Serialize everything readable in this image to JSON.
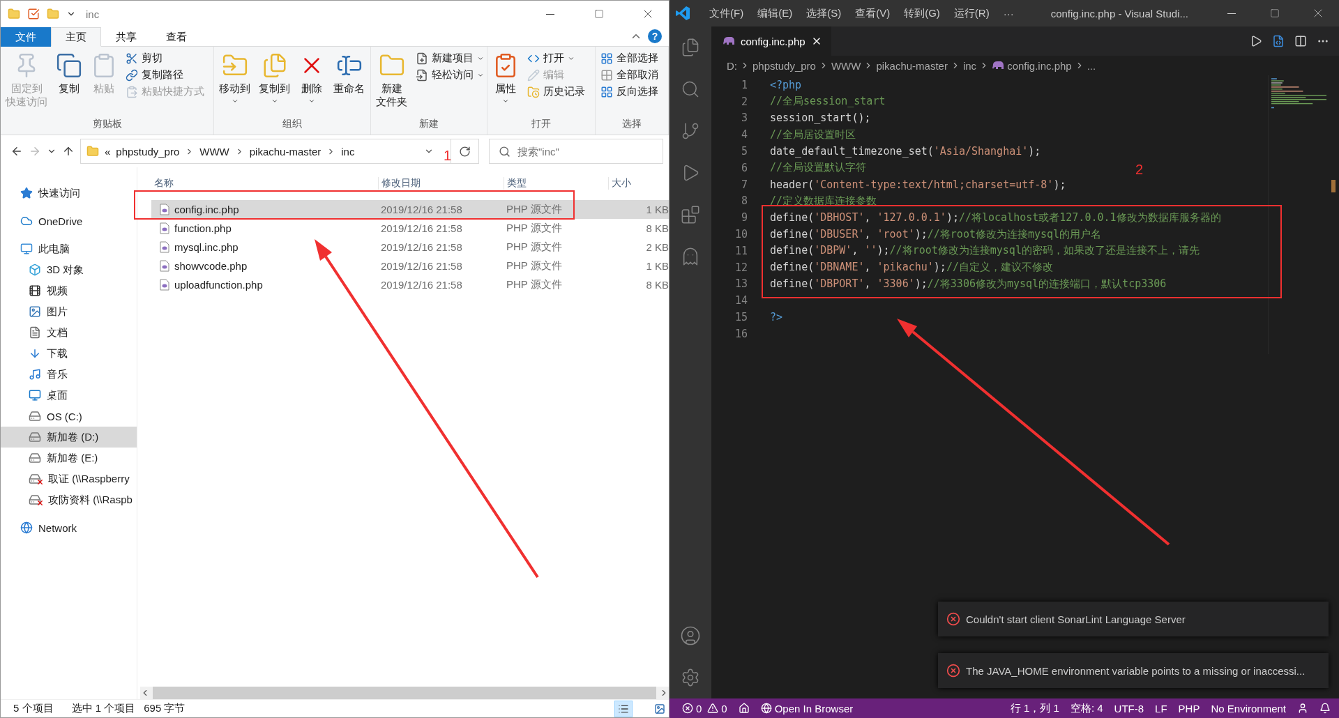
{
  "explorer": {
    "title": "inc",
    "help": "?",
    "ribbon_tabs": [
      {
        "label": "文件",
        "kind": "file",
        "selected": false
      },
      {
        "label": "主页",
        "kind": "tab",
        "selected": true
      },
      {
        "label": "共享",
        "kind": "tab",
        "selected": false
      },
      {
        "label": "查看",
        "kind": "tab",
        "selected": false
      }
    ],
    "ribbon_groups": [
      {
        "label": "剪贴板",
        "items": [
          {
            "kind": "large",
            "lines": [
              "固定到",
              "快速访问"
            ],
            "disabled": true
          },
          {
            "kind": "large",
            "label": "复制",
            "disabled": false
          },
          {
            "kind": "large",
            "label": "粘贴",
            "disabled": true
          },
          {
            "kind": "small",
            "label": "剪切",
            "disabled": false
          },
          {
            "kind": "small",
            "label": "复制路径",
            "disabled": false
          },
          {
            "kind": "small",
            "label": "粘贴快捷方式",
            "disabled": true
          }
        ]
      },
      {
        "label": "组织",
        "items": [
          {
            "kind": "large",
            "label": "移动到",
            "disabled": false,
            "dropdown": true
          },
          {
            "kind": "large",
            "label": "复制到",
            "disabled": false,
            "dropdown": true
          },
          {
            "kind": "large",
            "label": "删除",
            "disabled": false,
            "dropdown": true
          },
          {
            "kind": "large",
            "label": "重命名",
            "disabled": false
          }
        ]
      },
      {
        "label": "新建",
        "items": [
          {
            "kind": "large",
            "lines": [
              "新建",
              "文件夹"
            ],
            "disabled": false
          },
          {
            "kind": "small",
            "label": "新建项目",
            "disabled": false,
            "dropdown": true
          },
          {
            "kind": "small",
            "label": "轻松访问",
            "disabled": false,
            "dropdown": true
          }
        ]
      },
      {
        "label": "打开",
        "items": [
          {
            "kind": "large",
            "label": "属性",
            "disabled": false,
            "dropdown": true
          },
          {
            "kind": "small",
            "label": "打开",
            "disabled": false,
            "dropdown": true
          },
          {
            "kind": "small",
            "label": "编辑",
            "disabled": true
          },
          {
            "kind": "small",
            "label": "历史记录",
            "disabled": false
          }
        ]
      },
      {
        "label": "选择",
        "items": [
          {
            "kind": "small",
            "label": "全部选择",
            "disabled": false
          },
          {
            "kind": "small",
            "label": "全部取消",
            "disabled": false
          },
          {
            "kind": "small",
            "label": "反向选择",
            "disabled": false
          }
        ]
      }
    ],
    "address": {
      "overflow_mark": "«",
      "crumbs": [
        "phpstudy_pro",
        "WWW",
        "pikachu-master",
        "inc"
      ]
    },
    "search": {
      "placeholder": "搜索\"inc\""
    },
    "sidebar": [
      {
        "label": "快速访问",
        "selected": false
      },
      {
        "label": "OneDrive",
        "selected": false
      },
      {
        "label": "此电脑",
        "selected": false,
        "children": [
          {
            "label": "3D 对象",
            "selected": false
          },
          {
            "label": "视频",
            "selected": false
          },
          {
            "label": "图片",
            "selected": false
          },
          {
            "label": "文档",
            "selected": false
          },
          {
            "label": "下载",
            "selected": false
          },
          {
            "label": "音乐",
            "selected": false
          },
          {
            "label": "桌面",
            "selected": false
          },
          {
            "label": "OS (C:)",
            "selected": false
          },
          {
            "label": "新加卷 (D:)",
            "selected": true
          },
          {
            "label": "新加卷 (E:)",
            "selected": false
          },
          {
            "label": "取证 (\\\\Raspberry",
            "selected": false
          },
          {
            "label": "攻防资料 (\\\\Raspb",
            "selected": false
          }
        ]
      },
      {
        "label": "Network",
        "selected": false
      }
    ],
    "columns": [
      "名称",
      "修改日期",
      "类型",
      "大小"
    ],
    "rows": [
      {
        "name": "config.inc.php",
        "date": "2019/12/16 21:58",
        "type": "PHP 源文件",
        "size": "1 KB",
        "selected": true
      },
      {
        "name": "function.php",
        "date": "2019/12/16 21:58",
        "type": "PHP 源文件",
        "size": "8 KB",
        "selected": false
      },
      {
        "name": "mysql.inc.php",
        "date": "2019/12/16 21:58",
        "type": "PHP 源文件",
        "size": "2 KB",
        "selected": false
      },
      {
        "name": "showvcode.php",
        "date": "2019/12/16 21:58",
        "type": "PHP 源文件",
        "size": "1 KB",
        "selected": false
      },
      {
        "name": "uploadfunction.php",
        "date": "2019/12/16 21:58",
        "type": "PHP 源文件",
        "size": "8 KB",
        "selected": false
      }
    ],
    "status": {
      "item_count": "5 个项目",
      "selection": "选中 1 个项目",
      "size": "695 字节"
    },
    "view_buttons": [
      {
        "selected": true
      },
      {
        "selected": false
      }
    ]
  },
  "vscode": {
    "menu": [
      "文件(F)",
      "编辑(E)",
      "选择(S)",
      "查看(V)",
      "转到(G)",
      "运行(R)"
    ],
    "more": "···",
    "title": "config.inc.php - Visual Studi...",
    "tab": {
      "label": "config.inc.php"
    },
    "breadcrumbs": [
      {
        "label": "D:",
        "kind": "folder"
      },
      {
        "label": "phpstudy_pro",
        "kind": "folder"
      },
      {
        "label": "WWW",
        "kind": "folder"
      },
      {
        "label": "pikachu-master",
        "kind": "folder"
      },
      {
        "label": "inc",
        "kind": "folder"
      },
      {
        "label": "config.inc.php",
        "kind": "file"
      },
      {
        "label": "...",
        "kind": "more"
      }
    ],
    "code_lines": [
      {
        "number": "1",
        "segments": [
          {
            "kind": "tag",
            "text": "<?php"
          }
        ]
      },
      {
        "number": "2",
        "segments": [
          {
            "kind": "comment",
            "text": "//全局session_start"
          }
        ]
      },
      {
        "number": "3",
        "segments": [
          {
            "kind": "plain",
            "text": "session_start();"
          }
        ]
      },
      {
        "number": "4",
        "segments": [
          {
            "kind": "comment",
            "text": "//全局居设置时区"
          }
        ]
      },
      {
        "number": "5",
        "segments": [
          {
            "kind": "plain",
            "text": "date_default_timezone_set("
          },
          {
            "kind": "string",
            "text": "'Asia/Shanghai'"
          },
          {
            "kind": "plain",
            "text": ");"
          }
        ]
      },
      {
        "number": "6",
        "segments": [
          {
            "kind": "comment",
            "text": "//全局设置默认字符"
          }
        ]
      },
      {
        "number": "7",
        "segments": [
          {
            "kind": "plain",
            "text": "header("
          },
          {
            "kind": "string",
            "text": "'Content-type:text/html;charset=utf-8'"
          },
          {
            "kind": "plain",
            "text": ");"
          }
        ]
      },
      {
        "number": "8",
        "segments": [
          {
            "kind": "comment",
            "text": "//定义数据库连接参数"
          }
        ]
      },
      {
        "number": "9",
        "segments": [
          {
            "kind": "plain",
            "text": "define("
          },
          {
            "kind": "string",
            "text": "'DBHOST'"
          },
          {
            "kind": "plain",
            "text": ", "
          },
          {
            "kind": "string",
            "text": "'127.0.0.1'"
          },
          {
            "kind": "plain",
            "text": ");"
          },
          {
            "kind": "comment",
            "text": "//将localhost或者127.0.0.1修改为数据库服务器的"
          }
        ]
      },
      {
        "number": "10",
        "segments": [
          {
            "kind": "plain",
            "text": "define("
          },
          {
            "kind": "string",
            "text": "'DBUSER'"
          },
          {
            "kind": "plain",
            "text": ", "
          },
          {
            "kind": "string",
            "text": "'root'"
          },
          {
            "kind": "plain",
            "text": ");"
          },
          {
            "kind": "comment",
            "text": "//将root修改为连接mysql的用户名"
          }
        ]
      },
      {
        "number": "11",
        "segments": [
          {
            "kind": "plain",
            "text": "define("
          },
          {
            "kind": "string",
            "text": "'DBPW'"
          },
          {
            "kind": "plain",
            "text": ", "
          },
          {
            "kind": "string",
            "text": "''"
          },
          {
            "kind": "plain",
            "text": ");"
          },
          {
            "kind": "comment",
            "text": "//将root修改为连接mysql的密码，如果改了还是连接不上，请先"
          }
        ]
      },
      {
        "number": "12",
        "segments": [
          {
            "kind": "plain",
            "text": "define("
          },
          {
            "kind": "string",
            "text": "'DBNAME'"
          },
          {
            "kind": "plain",
            "text": ", "
          },
          {
            "kind": "string",
            "text": "'pikachu'"
          },
          {
            "kind": "plain",
            "text": ");"
          },
          {
            "kind": "comment",
            "text": "//自定义，建议不修改"
          }
        ]
      },
      {
        "number": "13",
        "segments": [
          {
            "kind": "plain",
            "text": "define("
          },
          {
            "kind": "string",
            "text": "'DBPORT'"
          },
          {
            "kind": "plain",
            "text": ", "
          },
          {
            "kind": "string",
            "text": "'3306'"
          },
          {
            "kind": "plain",
            "text": ");"
          },
          {
            "kind": "comment",
            "text": "//将3306修改为mysql的连接端口，默认tcp3306"
          }
        ]
      },
      {
        "number": "14"
      },
      {
        "number": "15",
        "segments": [
          {
            "kind": "tag",
            "text": "?>"
          }
        ]
      },
      {
        "number": "16"
      }
    ],
    "notifications": [
      {
        "message": "Couldn't start client SonarLint Language Server"
      },
      {
        "message": "The JAVA_HOME environment variable points to a missing or inaccessi..."
      }
    ],
    "status_bar": {
      "errors": "0",
      "warnings": "0",
      "open_in_browser": "Open In Browser",
      "items": [
        "行 1，列 1",
        "空格: 4",
        "UTF-8",
        "LF",
        "PHP",
        "No Environment"
      ]
    }
  },
  "annotations": [
    {
      "label": "1"
    },
    {
      "label": "2"
    }
  ]
}
